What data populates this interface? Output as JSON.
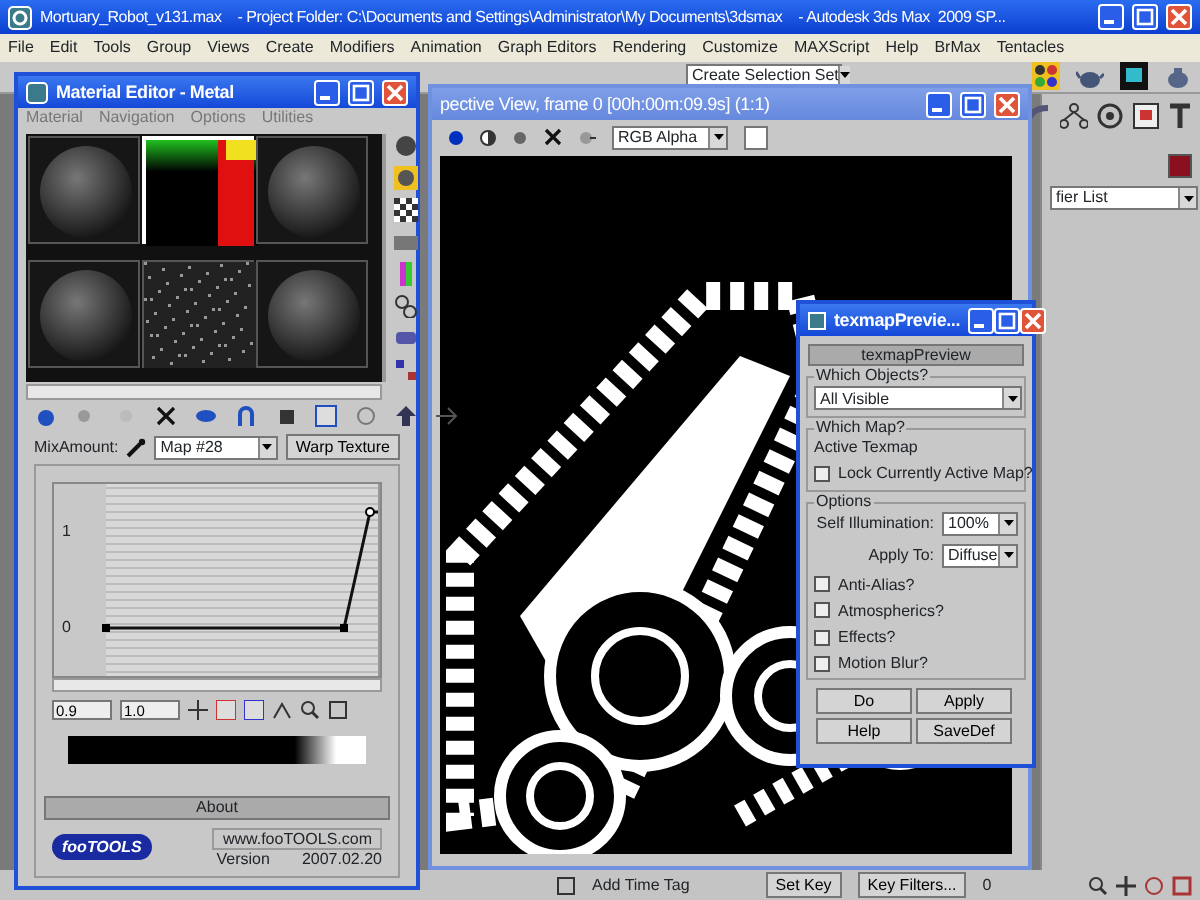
{
  "window": {
    "title_parts": [
      "Mortuary_Robot_v131.max",
      "- Project Folder: C:\\Documents and Settings\\Administrator\\My Documents\\3dsmax",
      "- Autodesk 3ds Max  2009 SP..."
    ]
  },
  "menu": [
    "File",
    "Edit",
    "Tools",
    "Group",
    "Views",
    "Create",
    "Modifiers",
    "Animation",
    "Graph Editors",
    "Rendering",
    "Customize",
    "MAXScript",
    "Help",
    "BrMax",
    "Tentacles"
  ],
  "toolbar": {
    "selection_set": "Create Selection Set"
  },
  "command_panel": {
    "modifier_list": "fier List"
  },
  "status_bar": {
    "time_tag": "Add Time Tag",
    "set_key": "Set Key",
    "key_filters": "Key Filters...",
    "frame": "0"
  },
  "material_editor": {
    "title": "Material Editor - Metal",
    "menu": [
      "Material",
      "Navigation",
      "Options",
      "Utilities"
    ],
    "slots": [
      {
        "kind": "sphere",
        "selected": false
      },
      {
        "kind": "gradient",
        "selected": true
      },
      {
        "kind": "sphere",
        "selected": false
      },
      {
        "kind": "sphere",
        "selected": false
      },
      {
        "kind": "noise",
        "selected": false
      },
      {
        "kind": "sphere",
        "selected": false
      }
    ],
    "mix_label": "MixAmount:",
    "map": "Map #28",
    "warp_button": "Warp Texture",
    "curve": {
      "y_labels": [
        "1",
        "0"
      ],
      "fields": [
        "0.9",
        "1.0"
      ]
    },
    "about": {
      "heading": "About",
      "logo": "fooTOOLS",
      "url": "www.fooTOOLS.com",
      "version_label": "Version",
      "version": "2007.02.20"
    }
  },
  "render_window": {
    "title": "pective View, frame 0 [00h:00m:09.9s] (1:1)",
    "channel": "RGB Alpha"
  },
  "texmap_preview": {
    "title": "texmapPrevie...",
    "rollout": "texmapPreview",
    "objects_group": "Which Objects?",
    "objects": "All Visible",
    "map_group": "Which Map?",
    "map_text": "Active Texmap",
    "lock": {
      "label": "Lock Currently Active Map?",
      "checked": false
    },
    "options_group": "Options",
    "self_illum_label": "Self Illumination:",
    "self_illum": "100%",
    "apply_to_label": "Apply To:",
    "apply_to": "Diffuse",
    "options": [
      {
        "label": "Anti-Alias?",
        "checked": false
      },
      {
        "label": "Atmospherics?",
        "checked": false
      },
      {
        "label": "Effects?",
        "checked": false
      },
      {
        "label": "Motion Blur?",
        "checked": false
      }
    ],
    "buttons": [
      "Do",
      "Apply",
      "Help",
      "SaveDef"
    ]
  }
}
